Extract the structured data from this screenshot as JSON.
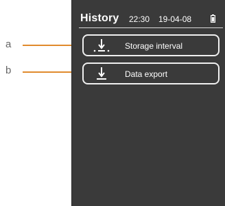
{
  "header": {
    "title": "History",
    "time": "22:30",
    "date": "19-04-08"
  },
  "menu": [
    {
      "label": "Storage interval",
      "icon": "storage-interval-icon"
    },
    {
      "label": "Data export",
      "icon": "download-icon"
    }
  ],
  "callouts": [
    {
      "letter": "a"
    },
    {
      "letter": "b"
    }
  ],
  "colors": {
    "screen": "#3a3a3a",
    "callout_line": "#e08a2c",
    "text": "#ffffff"
  }
}
